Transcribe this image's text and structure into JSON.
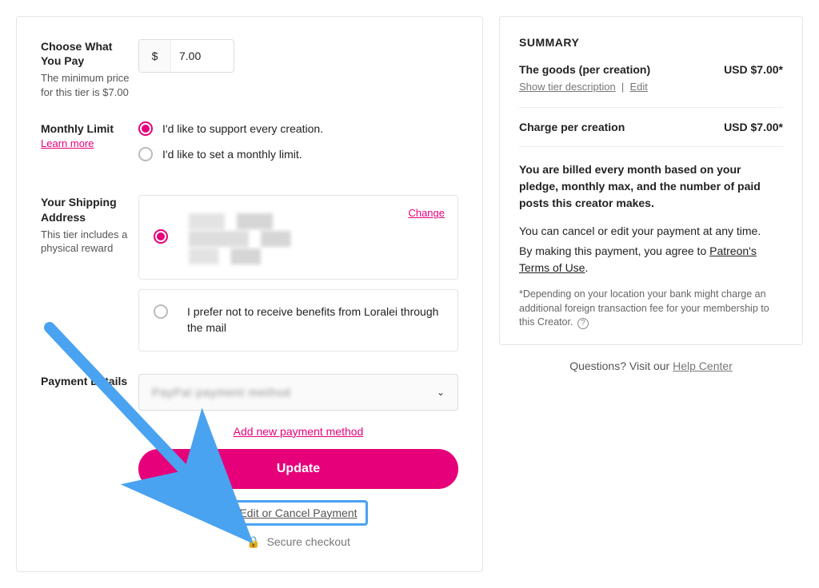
{
  "pricing": {
    "choose_title": "Choose What You Pay",
    "choose_subtitle": "The minimum price for this tier is $7.00",
    "currency_symbol": "$",
    "amount": "7.00"
  },
  "monthly": {
    "title": "Monthly Limit",
    "learn_more": "Learn more",
    "option_every": "I'd like to support every creation.",
    "option_limit": "I'd like to set a monthly limit."
  },
  "shipping": {
    "title": "Your Shipping Address",
    "subtitle": "This tier includes a physical reward",
    "change": "Change",
    "nomail_text": "I prefer not to receive benefits from Loralei through the mail"
  },
  "payment": {
    "title": "Payment Details",
    "dropdown_placeholder": "PayPal payment method",
    "add_new": "Add new payment method",
    "update": "Update",
    "edit_cancel": "Edit or Cancel Payment",
    "secure": "Secure checkout"
  },
  "summary": {
    "title": "SUMMARY",
    "goods_label": "The goods (per creation)",
    "goods_amount": "USD $7.00*",
    "show_tier": "Show tier description",
    "edit": "Edit",
    "charge_label": "Charge per creation",
    "charge_amount": "USD $7.00*",
    "billing_bold": "You are billed every month based on your pledge, monthly max, and the number of paid posts this creator makes.",
    "cancel_anytime": "You can cancel or edit your payment at any time.",
    "agree_prefix": "By making this payment, you agree to ",
    "terms_link": "Patreon's Terms of Use",
    "footnote": "*Depending on your location your bank might charge an additional foreign transaction fee for your membership to this Creator."
  },
  "questions": {
    "prefix": "Questions? Visit our ",
    "link": "Help Center"
  }
}
